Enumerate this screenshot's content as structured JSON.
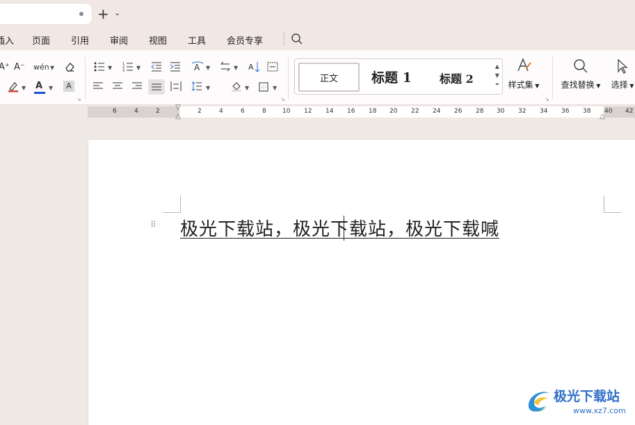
{
  "tabs": {
    "new_tab": "+",
    "new_tab_menu": "⌄"
  },
  "menu": {
    "items": [
      "插入",
      "页面",
      "引用",
      "审阅",
      "视图",
      "工具",
      "会员专享"
    ],
    "search_icon": "search-icon"
  },
  "ribbon": {
    "font_tools": {
      "grow_icon": "A⁺",
      "shrink_icon": "A⁻",
      "phonetic_icon": "wén",
      "clear_format_icon": "eraser-icon",
      "highlight_icon": "highlighter-icon",
      "font_color_label": "A",
      "char_shading_label": "A",
      "font_color": "#1e4fd8"
    },
    "paragraph_tools": {
      "bullets_icon": "bullet-list-icon",
      "numbering_icon": "numbered-list-icon",
      "decrease_indent_icon": "decrease-indent-icon",
      "increase_indent_icon": "increase-indent-icon",
      "text_direction_icon": "text-direction-icon",
      "sort_icon": "sort-icon",
      "show_marks_icon": "show-marks-icon",
      "align_left_icon": "align-left-icon",
      "align_center_icon": "align-center-icon",
      "align_right_icon": "align-right-icon",
      "align_justify_icon": "align-justify-icon",
      "distributed_icon": "distributed-icon",
      "line_spacing_icon": "line-spacing-icon",
      "shading_icon": "shading-icon",
      "borders_icon": "borders-icon"
    },
    "styles": {
      "normal": "正文",
      "heading1": "标题  1",
      "heading2": "标题  2"
    },
    "style_set_label": "样式集",
    "find_replace_label": "查找替换",
    "select_label": "选择"
  },
  "ruler": {
    "left_numbers": [
      "6",
      "4",
      "2"
    ],
    "right_numbers": [
      "2",
      "4",
      "6",
      "8",
      "10",
      "12",
      "14",
      "16",
      "18",
      "20",
      "22",
      "24",
      "26",
      "28",
      "30",
      "32",
      "34",
      "36",
      "38",
      "40",
      "42"
    ]
  },
  "document": {
    "text": "极光下载站，极光下载站，极光下载喊"
  },
  "watermark": {
    "title": "极光下载站",
    "url": "www.xz7.com"
  }
}
